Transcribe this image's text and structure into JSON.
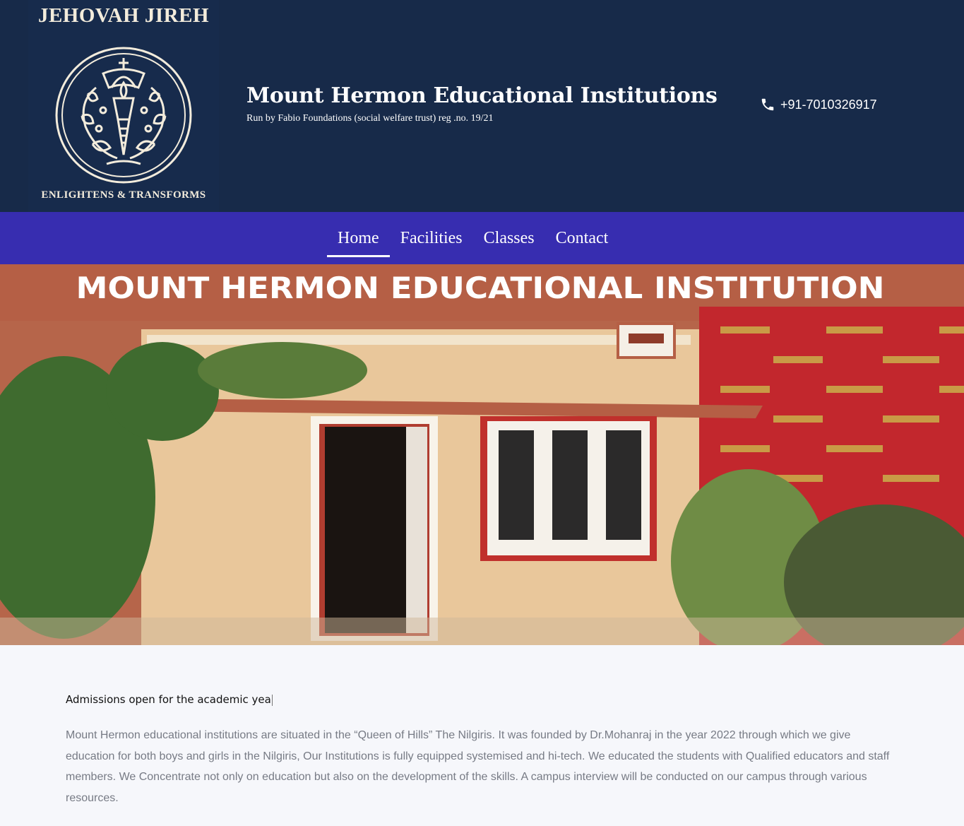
{
  "logo": {
    "top_text": "JEHOVAH JIREH",
    "bottom_text": "ENLIGHTENS & TRANSFORMS",
    "icon": "school-emblem-icon"
  },
  "header": {
    "title": "Mount Hermon Educational Institutions",
    "subtitle": "Run by Fabio Foundations (social welfare trust) reg .no. 19/21",
    "phone": "+91-7010326917",
    "phone_icon": "phone-icon"
  },
  "nav": {
    "items": [
      {
        "label": "Home",
        "active": true
      },
      {
        "label": "Facilities",
        "active": false
      },
      {
        "label": "Classes",
        "active": false
      },
      {
        "label": "Contact",
        "active": false
      }
    ]
  },
  "hero": {
    "sign_text": "MOUNT HERMON EDUCATIONAL INSTITUTION"
  },
  "content": {
    "admissions": "Admissions open for the academic yea",
    "about": "Mount Hermon educational institutions are situated in the “Queen of Hills” The Nilgiris. It was founded by Dr.Mohanraj in the year 2022 through which we give education for both boys and girls in the Nilgiris, Our Institutions is fully equipped systemised and hi-tech. We educated the students with Qualified educators and staff members. We Concentrate not only on education but also on the development of the skills. A campus interview will be conducted on our campus through various resources."
  },
  "colors": {
    "header_bg": "#172a49",
    "nav_bg": "#372db0",
    "page_bg": "#f6f7fb",
    "body_text": "#777b85"
  }
}
